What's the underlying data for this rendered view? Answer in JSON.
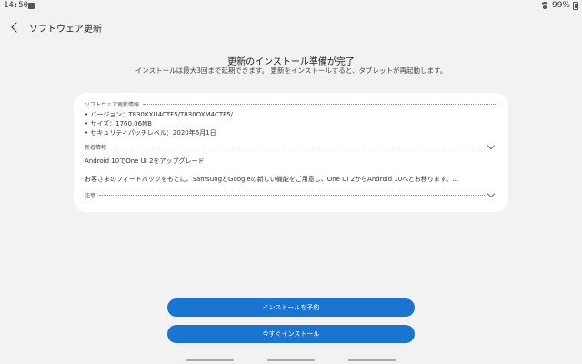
{
  "status_bar": {
    "time": "14:50",
    "battery": "99%"
  },
  "header": {
    "title": "ソフトウェア更新"
  },
  "main": {
    "heading": "更新のインストール準備が完了",
    "subheading": "インストールは最大3回まで延期できます。 更新をインストールすると、タブレットが再起動します。"
  },
  "card": {
    "info_title": "ソフトウェア更新情報",
    "info_lines": [
      "• バージョン：T830XXU4CTF5/T830OXM4CTF5/",
      "• サイズ：1760.06MB",
      "• セキュリティパッチレベル：2020年6月1日"
    ],
    "whats_new_title": "新着情報",
    "whats_new_lines": [
      "Android 10でOne UI 2をアップグレード",
      "お客さまのフィードバックをもとに、SamsungとGoogleの新しい機能をご用意し、One UI 2からAndroid 10へとお移ります。…"
    ],
    "notes_title": "注意"
  },
  "buttons": {
    "schedule": "インストールを予約",
    "install_now": "今すぐインストール"
  },
  "colors": {
    "accent": "#1a74d2",
    "background": "#f2f2f2"
  }
}
